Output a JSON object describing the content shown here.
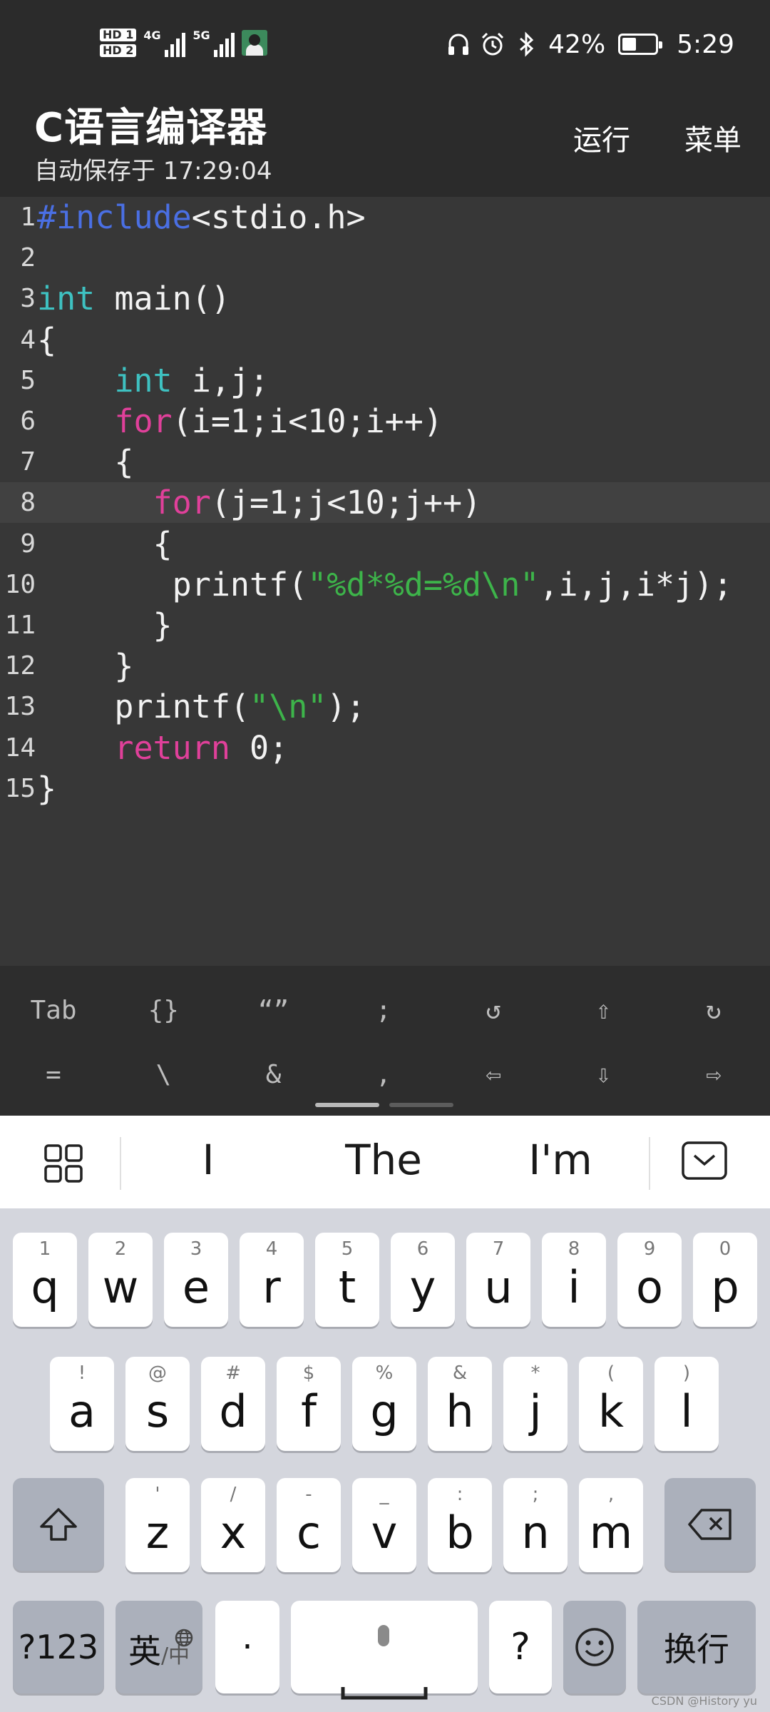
{
  "status_bar": {
    "hd1": "HD 1",
    "hd2": "HD 2",
    "net1": "4G",
    "net2": "5G",
    "icons": [
      "headphones-icon",
      "alarm-icon",
      "bluetooth-icon"
    ],
    "battery": "42%",
    "battery_level": 0.42,
    "time": "5:29"
  },
  "app_bar": {
    "title": "C语言编译器",
    "subtitle": "自动保存于 17:29:04",
    "run_label": "运行",
    "menu_label": "菜单"
  },
  "editor": {
    "current_line": 8,
    "lines": [
      {
        "no": "1",
        "text": "#include<stdio.h>"
      },
      {
        "no": "2",
        "text": ""
      },
      {
        "no": "3",
        "text": "int main()"
      },
      {
        "no": "4",
        "text": "{"
      },
      {
        "no": "5",
        "text": "    int i,j;"
      },
      {
        "no": "6",
        "text": "    for(i=1;i<10;i++)"
      },
      {
        "no": "7",
        "text": "    {"
      },
      {
        "no": "8",
        "text": "      for(j=1;j<10;j++)"
      },
      {
        "no": "9",
        "text": "      {"
      },
      {
        "no": "10",
        "text": "       printf(\"%d*%d=%d\\n\",i,j,i*j);"
      },
      {
        "no": "11",
        "text": "      }"
      },
      {
        "no": "12",
        "text": "    }"
      },
      {
        "no": "13",
        "text": "    printf(\"\\n\");"
      },
      {
        "no": "14",
        "text": "    return 0;"
      },
      {
        "no": "15",
        "text": "}"
      }
    ]
  },
  "symbols": {
    "row1": [
      "Tab",
      "{}",
      "“”",
      ";",
      "↺",
      "⇧",
      "↻"
    ],
    "row2": [
      "=",
      "\\",
      "&",
      ",",
      "⇦",
      "⇩",
      "⇨"
    ]
  },
  "suggestions": {
    "words": [
      "I",
      "The",
      "I'm"
    ]
  },
  "keyboard": {
    "row1": [
      [
        "q",
        "1"
      ],
      [
        "w",
        "2"
      ],
      [
        "e",
        "3"
      ],
      [
        "r",
        "4"
      ],
      [
        "t",
        "5"
      ],
      [
        "y",
        "6"
      ],
      [
        "u",
        "7"
      ],
      [
        "i",
        "8"
      ],
      [
        "o",
        "9"
      ],
      [
        "p",
        "0"
      ]
    ],
    "row2": [
      [
        "a",
        "!"
      ],
      [
        "s",
        "@"
      ],
      [
        "d",
        "#"
      ],
      [
        "f",
        "$"
      ],
      [
        "g",
        "%"
      ],
      [
        "h",
        "&"
      ],
      [
        "j",
        "*"
      ],
      [
        "k",
        "("
      ],
      [
        "l",
        ")"
      ]
    ],
    "row3": [
      [
        "z",
        "'"
      ],
      [
        "x",
        "/"
      ],
      [
        "c",
        "-"
      ],
      [
        "v",
        "_"
      ],
      [
        "b",
        ":"
      ],
      [
        "n",
        ";"
      ],
      [
        "m",
        ","
      ]
    ],
    "num_label": "?123",
    "lang_label": "英",
    "lang_sub": "/中",
    "dot_label": "·",
    "question_label": "?",
    "enter_label": "换行"
  },
  "watermark": "CSDN @History yu"
}
